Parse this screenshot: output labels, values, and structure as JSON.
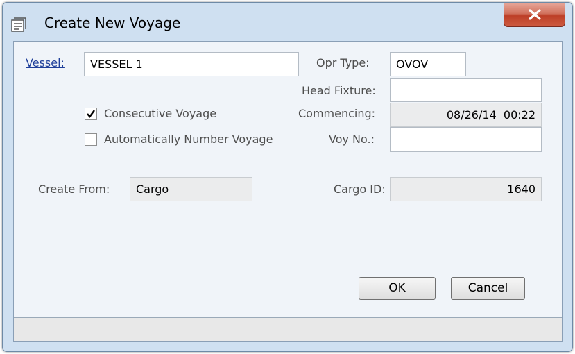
{
  "window": {
    "title": "Create New Voyage"
  },
  "form": {
    "vessel_label": "Vessel:",
    "vessel_value": "VESSEL 1",
    "opr_type_label": "Opr Type:",
    "opr_type_value": "OVOV",
    "head_fixture_label": "Head Fixture:",
    "head_fixture_value": "",
    "consecutive_label": "Consecutive Voyage",
    "consecutive_checked": true,
    "auto_number_label": "Automatically Number Voyage",
    "auto_number_checked": false,
    "commencing_label": "Commencing:",
    "commencing_value": "08/26/14  00:22",
    "voy_no_label": "Voy No.:",
    "voy_no_value": "",
    "create_from_label": "Create From:",
    "create_from_value": "Cargo",
    "cargo_id_label": "Cargo ID:",
    "cargo_id_value": "1640"
  },
  "buttons": {
    "ok": "OK",
    "cancel": "Cancel"
  },
  "status_bar": {
    "text": ""
  },
  "icons": {
    "window": "document-icon",
    "close": "close-icon",
    "checkmark": "checkmark-icon"
  },
  "colors": {
    "window_frame": "#cfe0f1",
    "client_area": "#f0f4f9",
    "close_button": "#c9462d",
    "link": "#1f3f9a"
  }
}
